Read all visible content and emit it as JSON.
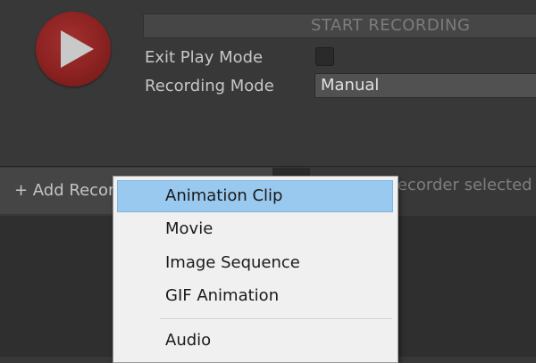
{
  "recorder": {
    "start_label": "START RECORDING",
    "exit_play_mode_label": "Exit Play Mode",
    "exit_play_mode_checked": false,
    "recording_mode_label": "Recording Mode",
    "recording_mode_value": "Manual"
  },
  "recorder_list": {
    "add_recorder_label": "+ Add Recorder",
    "empty_message": "No Recorder selected"
  },
  "add_menu": {
    "items": [
      {
        "label": "Animation Clip",
        "highlighted": true
      },
      {
        "label": "Movie",
        "highlighted": false
      },
      {
        "label": "Image Sequence",
        "highlighted": false
      },
      {
        "label": "GIF Animation",
        "highlighted": false
      },
      {
        "label": "Audio",
        "highlighted": false
      }
    ]
  },
  "colors": {
    "record_button": "#8a2221",
    "menu_highlight": "#99c9ef"
  },
  "icons": {
    "record": "play-icon"
  }
}
